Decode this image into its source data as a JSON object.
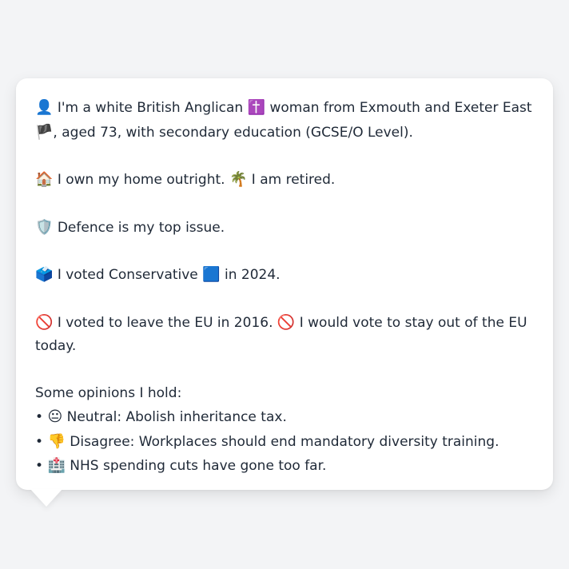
{
  "persona": {
    "intro_emoji": "👤",
    "intro_text_1": "I'm a white British Anglican",
    "religion_emoji": "✝️",
    "intro_text_2": "woman from Exmouth and Exeter East",
    "flag_emoji": "🏴",
    "intro_text_3": ", aged 73, with secondary education (GCSE/O Level).",
    "home_emoji": "🏠",
    "home_text": "I own my home outright.",
    "retired_emoji": "🌴",
    "retired_text": "I am retired.",
    "issue_emoji": "🛡️",
    "issue_text": "Defence is my top issue.",
    "vote_emoji": "🗳️",
    "vote_text_1": "I voted Conservative",
    "party_emoji": "🟦",
    "vote_text_2": "in 2024.",
    "eu_emoji_1": "🚫",
    "eu_text_1": "I voted to leave the EU in 2016.",
    "eu_emoji_2": "🚫",
    "eu_text_2": "I would vote to stay out of the EU today.",
    "opinions_header": "Some opinions I hold:",
    "opinions": [
      {
        "bullet": "•",
        "emoji": "😐",
        "text": "Neutral: Abolish inheritance tax."
      },
      {
        "bullet": "•",
        "emoji": "👎",
        "text": "Disagree: Workplaces should end mandatory diversity training."
      },
      {
        "bullet": "•",
        "emoji": "🏥",
        "text": "NHS spending cuts have gone too far."
      }
    ]
  }
}
